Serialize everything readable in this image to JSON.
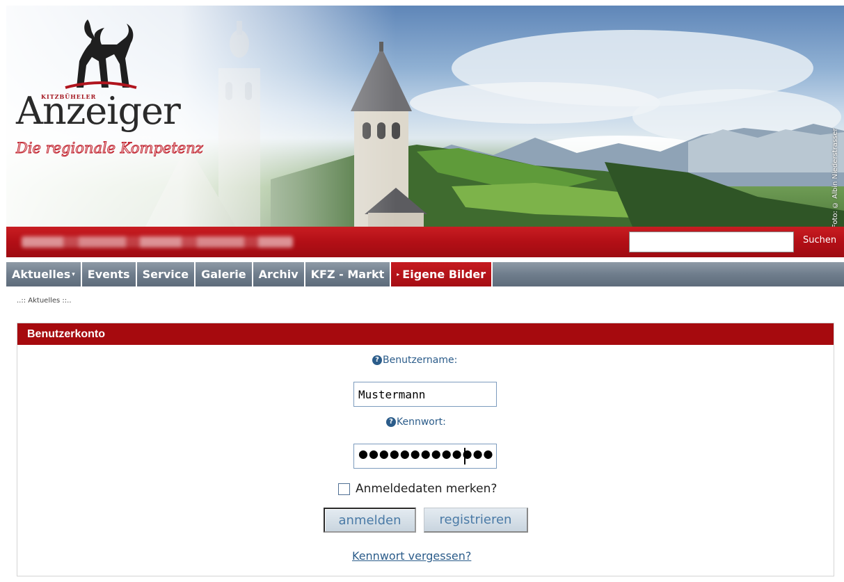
{
  "header": {
    "logo_small": "KITZBÜHELER",
    "logo_main": "Anzeiger",
    "tagline": "Die regionale Kompetenz",
    "photo_credit": "Foto: © Albin Niederstrasser"
  },
  "topbar": {
    "search_button": "Suchen",
    "search_value": ""
  },
  "nav": {
    "items": [
      {
        "label": "Aktuelles",
        "has_dropdown": true,
        "active": false
      },
      {
        "label": "Events",
        "active": false
      },
      {
        "label": "Service",
        "active": false
      },
      {
        "label": "Galerie",
        "active": false
      },
      {
        "label": "Archiv",
        "active": false
      },
      {
        "label": "KFZ - Markt",
        "active": false
      },
      {
        "label": "Eigene Bilder",
        "active": true
      }
    ]
  },
  "breadcrumb": "..:: Aktuelles ::..",
  "account": {
    "title": "Benutzerkonto",
    "username_label": "Benutzername:",
    "username_value": "Mustermann",
    "password_label": "Kennwort:",
    "password_value": "●●●●●●●●●●●●●",
    "remember_label": "Anmeldedaten merken?",
    "remember_checked": false,
    "login_button": "anmelden",
    "register_button": "registrieren",
    "forgot_link": "Kennwort vergessen?"
  },
  "colors": {
    "brand_red": "#a60a0e",
    "nav_gray": "#6f7d8c",
    "link_blue": "#2b5c8a"
  }
}
